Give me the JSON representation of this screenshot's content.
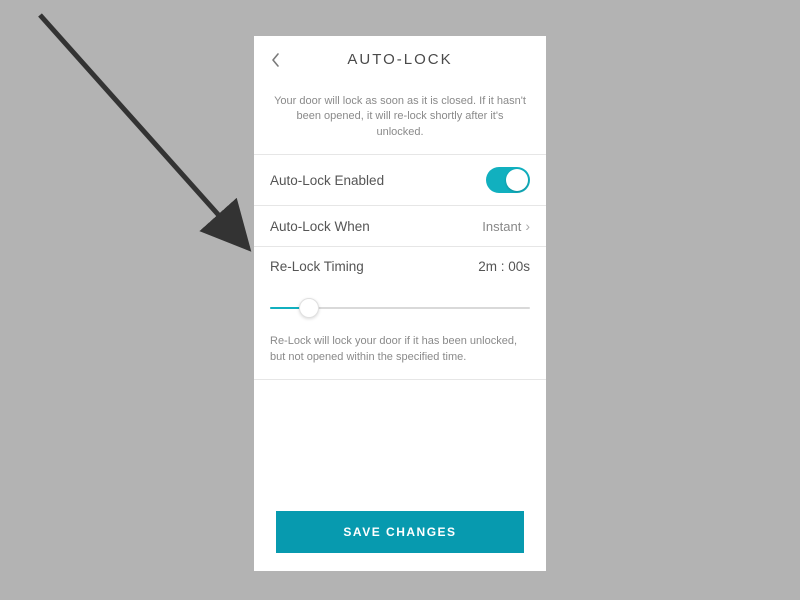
{
  "header": {
    "title": "AUTO-LOCK"
  },
  "description": "Your door will lock as soon as it is closed. If it hasn't been opened, it will re-lock shortly after it's unlocked.",
  "rows": {
    "enabled": {
      "label": "Auto-Lock Enabled"
    },
    "when": {
      "label": "Auto-Lock When",
      "value": "Instant"
    },
    "relock": {
      "label": "Re-Lock Timing",
      "value": "2m : 00s"
    }
  },
  "relockDescription": "Re-Lock will lock your door if it has been unlocked, but not opened within the specified time.",
  "saveButton": "SAVE CHANGES"
}
